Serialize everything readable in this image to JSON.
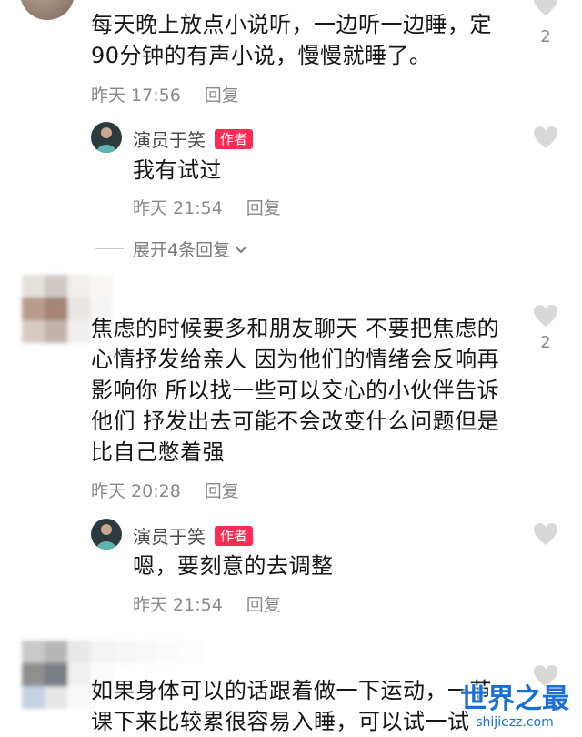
{
  "comments": [
    {
      "text_lines": [
        "每天晚上放点小说听，一边听一边睡，定",
        "90分钟的有声小说，慢慢就睡了。"
      ],
      "time": "昨天 17:56",
      "reply_label": "回复",
      "likes": "2",
      "reply": {
        "author": "演员于笑",
        "badge": "作者",
        "text": "我有试过",
        "time": "昨天 21:54",
        "reply_label": "回复"
      },
      "expand_label": "展开4条回复"
    },
    {
      "text_lines": [
        "焦虑的时候要多和朋友聊天 不要把焦虑的",
        "心情抒发给亲人 因为他们的情绪会反响再",
        "影响你 所以找一些可以交心的小伙伴告诉",
        "他们 抒发出去可能不会改变什么问题但是",
        "比自己憋着强"
      ],
      "time": "昨天 20:28",
      "reply_label": "回复",
      "likes": "2",
      "reply": {
        "author": "演员于笑",
        "badge": "作者",
        "text": "嗯，要刻意的去调整",
        "time": "昨天 21:54",
        "reply_label": "回复"
      }
    },
    {
      "text_lines": [
        "如果身体可以的话跟着做一下运动，一节",
        "课下来比较累很容易入睡，可以试一试"
      ]
    }
  ],
  "watermark": {
    "title": "世界之最",
    "url": "shijiezz.com"
  },
  "colors": {
    "badge": "#fe2c55",
    "meta_text": "#8a8a8a",
    "watermark": "#1a6fd6"
  }
}
